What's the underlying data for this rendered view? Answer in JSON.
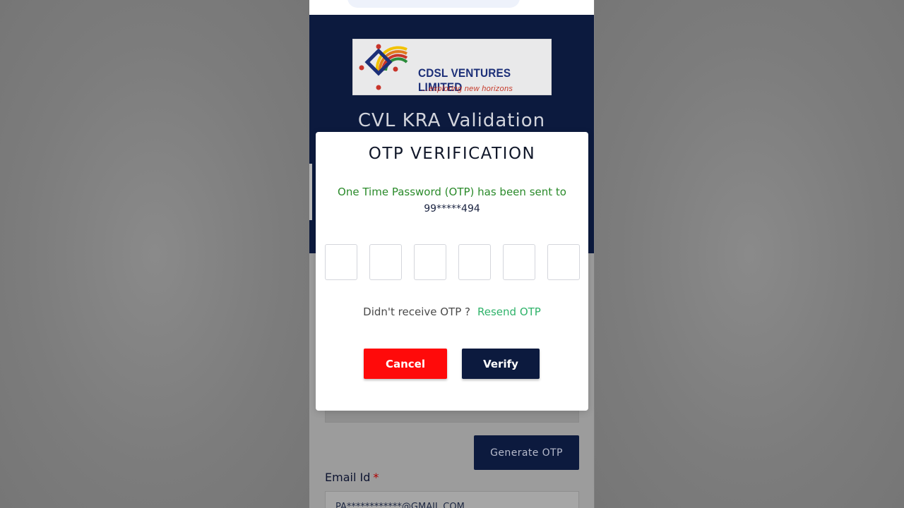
{
  "brand": {
    "company_name": "CDSL VENTURES LIMITED",
    "tagline": "...exploring new horizons",
    "logo_icon": "cdsl-logo-icon"
  },
  "page": {
    "title": "CVL KRA Validation"
  },
  "form": {
    "generate_otp_label": "Generate OTP",
    "email_label": "Email Id",
    "email_required_mark": "*",
    "email_value": "PA************@GMAIL.COM"
  },
  "modal": {
    "title": "OTP VERIFICATION",
    "message": "One Time Password (OTP) has been sent to",
    "masked_phone": "99*****494",
    "otp_digits": [
      "",
      "",
      "",
      "",
      "",
      ""
    ],
    "resend_prompt": "Didn't receive OTP ?",
    "resend_link": "Resend OTP",
    "cancel_label": "Cancel",
    "verify_label": "Verify"
  },
  "colors": {
    "navy": "#0c1a3e",
    "cancel_red": "#ff0a0a",
    "success_green": "#2a8a2a",
    "link_green": "#2fb36a"
  }
}
